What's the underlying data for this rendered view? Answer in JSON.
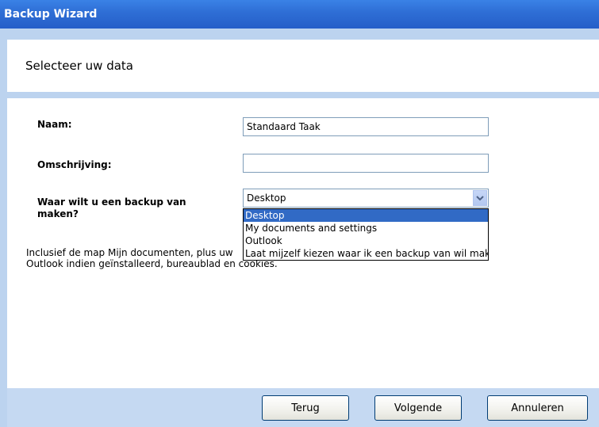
{
  "window": {
    "title": "Backup Wizard"
  },
  "header": {
    "subtitle": "Selecteer uw data"
  },
  "form": {
    "name_label": "Naam:",
    "name_value": "Standaard Taak",
    "description_label": "Omschrijving:",
    "description_value": "",
    "source_label_line1": "Waar wilt u een backup van",
    "source_label_line2": "maken?",
    "source_selected": "Desktop",
    "source_options": [
      "Desktop",
      "My documents and settings",
      "Outlook",
      "Laat mijzelf kiezen waar ik een backup van wil make"
    ],
    "description_line1": "Inclusief de map Mijn documenten, plus uw",
    "description_line2": "Outlook indien geïnstalleerd, bureaublad en cookies."
  },
  "buttons": {
    "back": "Terug",
    "next": "Volgende",
    "cancel": "Annuleren"
  },
  "colors": {
    "titlebar": "#2f6fd6",
    "selection": "#316ac5",
    "frame": "#bcd3ef"
  }
}
